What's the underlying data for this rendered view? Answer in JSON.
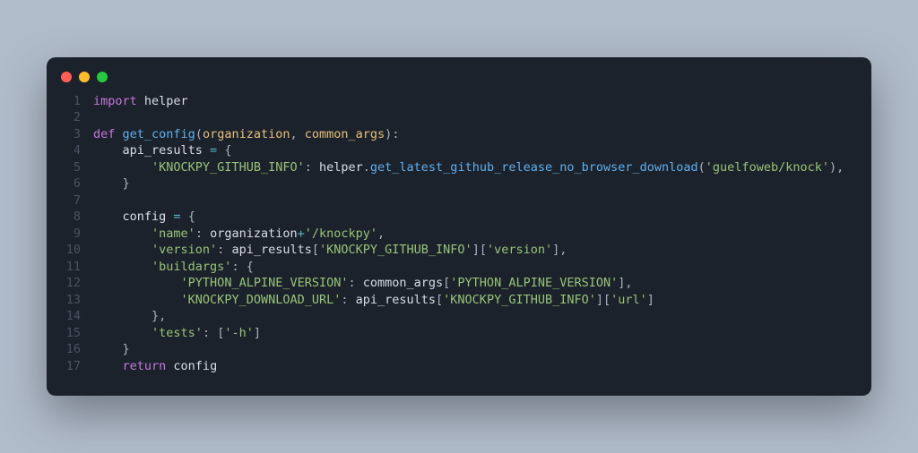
{
  "colors": {
    "bg": "#b1bccb",
    "window": "#1c222b",
    "red": "#ff5f56",
    "yellow": "#ffbd2e",
    "green": "#27c93f",
    "keyword": "#c678dd",
    "function": "#61afef",
    "identifier": "#e06c75",
    "string": "#98c379",
    "operator": "#56b6c2",
    "punctuation": "#abb2bf",
    "param": "#e5c07b",
    "lineno": "#4a5261"
  },
  "lines": [
    {
      "n": "1",
      "tokens": [
        {
          "c": "kw",
          "t": "import"
        },
        {
          "c": "default",
          "t": " helper"
        }
      ]
    },
    {
      "n": "2",
      "tokens": []
    },
    {
      "n": "3",
      "tokens": [
        {
          "c": "kw",
          "t": "def"
        },
        {
          "c": "default",
          "t": " "
        },
        {
          "c": "fn",
          "t": "get_config"
        },
        {
          "c": "punc",
          "t": "("
        },
        {
          "c": "param",
          "t": "organization"
        },
        {
          "c": "punc",
          "t": ", "
        },
        {
          "c": "param",
          "t": "common_args"
        },
        {
          "c": "punc",
          "t": ")"
        },
        {
          "c": "punc",
          "t": ":"
        }
      ]
    },
    {
      "n": "4",
      "tokens": [
        {
          "c": "default",
          "t": "    api_results "
        },
        {
          "c": "op",
          "t": "="
        },
        {
          "c": "default",
          "t": " "
        },
        {
          "c": "punc",
          "t": "{"
        }
      ]
    },
    {
      "n": "5",
      "tokens": [
        {
          "c": "default",
          "t": "        "
        },
        {
          "c": "str",
          "t": "'KNOCKPY_GITHUB_INFO'"
        },
        {
          "c": "punc",
          "t": ": "
        },
        {
          "c": "default",
          "t": "helper"
        },
        {
          "c": "punc",
          "t": "."
        },
        {
          "c": "fn",
          "t": "get_latest_github_release_no_browser_download"
        },
        {
          "c": "punc",
          "t": "("
        },
        {
          "c": "str",
          "t": "'guelfoweb/knock'"
        },
        {
          "c": "punc",
          "t": "),"
        }
      ]
    },
    {
      "n": "6",
      "tokens": [
        {
          "c": "default",
          "t": "    "
        },
        {
          "c": "punc",
          "t": "}"
        }
      ]
    },
    {
      "n": "7",
      "tokens": []
    },
    {
      "n": "8",
      "tokens": [
        {
          "c": "default",
          "t": "    config "
        },
        {
          "c": "op",
          "t": "="
        },
        {
          "c": "default",
          "t": " "
        },
        {
          "c": "punc",
          "t": "{"
        }
      ]
    },
    {
      "n": "9",
      "tokens": [
        {
          "c": "default",
          "t": "        "
        },
        {
          "c": "str",
          "t": "'name'"
        },
        {
          "c": "punc",
          "t": ": "
        },
        {
          "c": "default",
          "t": "organization"
        },
        {
          "c": "op",
          "t": "+"
        },
        {
          "c": "str",
          "t": "'/knockpy'"
        },
        {
          "c": "punc",
          "t": ","
        }
      ]
    },
    {
      "n": "10",
      "tokens": [
        {
          "c": "default",
          "t": "        "
        },
        {
          "c": "str",
          "t": "'version'"
        },
        {
          "c": "punc",
          "t": ": "
        },
        {
          "c": "default",
          "t": "api_results"
        },
        {
          "c": "punc",
          "t": "["
        },
        {
          "c": "str",
          "t": "'KNOCKPY_GITHUB_INFO'"
        },
        {
          "c": "punc",
          "t": "]["
        },
        {
          "c": "str",
          "t": "'version'"
        },
        {
          "c": "punc",
          "t": "],"
        }
      ]
    },
    {
      "n": "11",
      "tokens": [
        {
          "c": "default",
          "t": "        "
        },
        {
          "c": "str",
          "t": "'buildargs'"
        },
        {
          "c": "punc",
          "t": ": {"
        }
      ]
    },
    {
      "n": "12",
      "tokens": [
        {
          "c": "default",
          "t": "            "
        },
        {
          "c": "str",
          "t": "'PYTHON_ALPINE_VERSION'"
        },
        {
          "c": "punc",
          "t": ": "
        },
        {
          "c": "default",
          "t": "common_args"
        },
        {
          "c": "punc",
          "t": "["
        },
        {
          "c": "str",
          "t": "'PYTHON_ALPINE_VERSION'"
        },
        {
          "c": "punc",
          "t": "],"
        }
      ]
    },
    {
      "n": "13",
      "tokens": [
        {
          "c": "default",
          "t": "            "
        },
        {
          "c": "str",
          "t": "'KNOCKPY_DOWNLOAD_URL'"
        },
        {
          "c": "punc",
          "t": ": "
        },
        {
          "c": "default",
          "t": "api_results"
        },
        {
          "c": "punc",
          "t": "["
        },
        {
          "c": "str",
          "t": "'KNOCKPY_GITHUB_INFO'"
        },
        {
          "c": "punc",
          "t": "]["
        },
        {
          "c": "str",
          "t": "'url'"
        },
        {
          "c": "punc",
          "t": "]"
        }
      ]
    },
    {
      "n": "14",
      "tokens": [
        {
          "c": "default",
          "t": "        "
        },
        {
          "c": "punc",
          "t": "},"
        }
      ]
    },
    {
      "n": "15",
      "tokens": [
        {
          "c": "default",
          "t": "        "
        },
        {
          "c": "str",
          "t": "'tests'"
        },
        {
          "c": "punc",
          "t": ": ["
        },
        {
          "c": "str",
          "t": "'-h'"
        },
        {
          "c": "punc",
          "t": "]"
        }
      ]
    },
    {
      "n": "16",
      "tokens": [
        {
          "c": "default",
          "t": "    "
        },
        {
          "c": "punc",
          "t": "}"
        }
      ]
    },
    {
      "n": "17",
      "tokens": [
        {
          "c": "default",
          "t": "    "
        },
        {
          "c": "kw",
          "t": "return"
        },
        {
          "c": "default",
          "t": " config"
        }
      ]
    }
  ]
}
